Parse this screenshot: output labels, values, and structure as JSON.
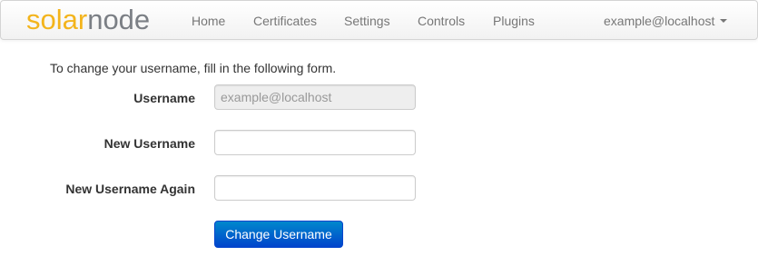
{
  "brand": {
    "part1": "solar",
    "part2": "node"
  },
  "nav": {
    "items": [
      "Home",
      "Certificates",
      "Settings",
      "Controls",
      "Plugins"
    ],
    "user": "example@localhost"
  },
  "form": {
    "intro": "To change your username, fill in the following form.",
    "username_label": "Username",
    "username_value": "example@localhost",
    "new_username_label": "New Username",
    "new_username_value": "",
    "new_username_again_label": "New Username Again",
    "new_username_again_value": "",
    "submit_label": "Change Username"
  },
  "colors": {
    "brand_solar": "#f3b41c",
    "brand_node": "#7b7f85",
    "primary_button": "#0055cc"
  }
}
